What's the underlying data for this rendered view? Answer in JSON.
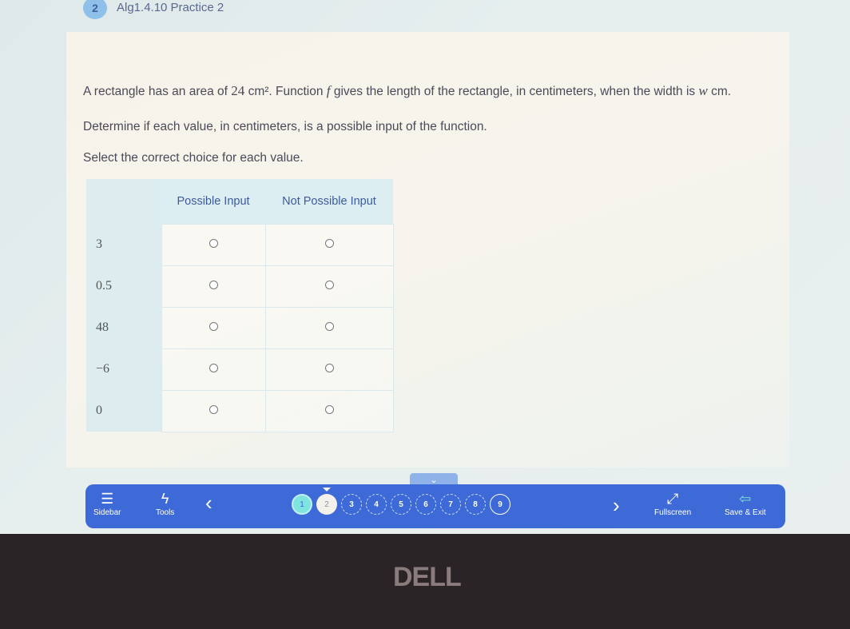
{
  "header": {
    "question_number": "2",
    "title": "Alg1.4.10 Practice 2"
  },
  "prompt": {
    "line1_before_area": "A rectangle has an area of ",
    "area_value": "24",
    "area_unit": "cm²",
    "line1_middle": ". Function ",
    "function_name": "f",
    "line1_after": " gives the length of the rectangle, in centimeters, when the width is ",
    "width_variable": "w",
    "line1_end": " cm.",
    "line2": "Determine if each value, in centimeters, is a possible input of the function.",
    "line3": "Select the correct choice for each value."
  },
  "table": {
    "columns": [
      "Possible Input",
      "Not Possible Input"
    ],
    "rows": [
      {
        "value": "3"
      },
      {
        "value": "0.5"
      },
      {
        "value": "48"
      },
      {
        "value": "−6"
      },
      {
        "value": "0"
      }
    ]
  },
  "navbar": {
    "sidebar_label": "Sidebar",
    "tools_label": "Tools",
    "prev_icon": "‹",
    "next_icon": "›",
    "fullscreen_label": "Fullscreen",
    "save_exit_label": "Save & Exit",
    "pages": [
      "1",
      "2",
      "3",
      "4",
      "5",
      "6",
      "7",
      "8",
      "9"
    ],
    "completed_pages": [
      "1"
    ],
    "current_page": "2"
  },
  "bezel": {
    "brand": "DELL"
  }
}
